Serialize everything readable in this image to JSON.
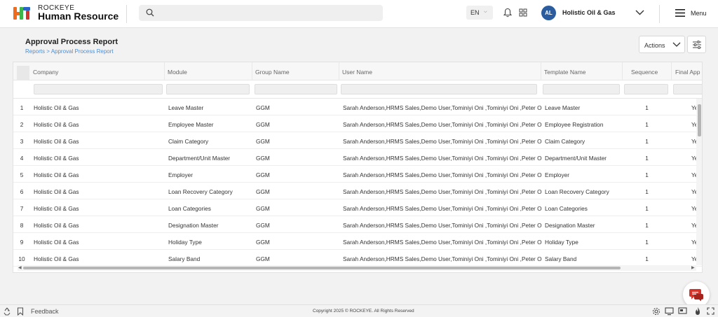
{
  "app": {
    "brand_top": "ROCKEYE",
    "brand_main": "Human Resource",
    "language": "EN",
    "avatar_initials": "AL",
    "organization": "Holistic Oil & Gas",
    "menu_label": "Menu"
  },
  "page": {
    "title": "Approval Process Report",
    "breadcrumb": "Reports > Approval Process Report",
    "actions_label": "Actions"
  },
  "table": {
    "columns": [
      "Company",
      "Module",
      "Group Name",
      "User Name",
      "Template Name",
      "Sequence",
      "Final App"
    ],
    "rows": [
      {
        "num": "1",
        "company": "Holistic Oil & Gas",
        "module": "Leave Master",
        "group": "GGM",
        "user": "Sarah Anderson,HRMS Sales,Demo User,Tominiyi Oni ,Tominiyi Oni ,Peter O",
        "template": "Leave Master",
        "sequence": "1",
        "final": "Ye"
      },
      {
        "num": "2",
        "company": "Holistic Oil & Gas",
        "module": "Employee Master",
        "group": "GGM",
        "user": "Sarah Anderson,HRMS Sales,Demo User,Tominiyi Oni ,Tominiyi Oni ,Peter O",
        "template": "Employee Registration",
        "sequence": "1",
        "final": "Ye"
      },
      {
        "num": "3",
        "company": "Holistic Oil & Gas",
        "module": "Claim Category",
        "group": "GGM",
        "user": "Sarah Anderson,HRMS Sales,Demo User,Tominiyi Oni ,Tominiyi Oni ,Peter O",
        "template": "Claim Category",
        "sequence": "1",
        "final": "Ye"
      },
      {
        "num": "4",
        "company": "Holistic Oil & Gas",
        "module": "Department/Unit Master",
        "group": "GGM",
        "user": "Sarah Anderson,HRMS Sales,Demo User,Tominiyi Oni ,Tominiyi Oni ,Peter O",
        "template": "Department/Unit Master",
        "sequence": "1",
        "final": "Ye"
      },
      {
        "num": "5",
        "company": "Holistic Oil & Gas",
        "module": "Employer",
        "group": "GGM",
        "user": "Sarah Anderson,HRMS Sales,Demo User,Tominiyi Oni ,Tominiyi Oni ,Peter O",
        "template": "Employer",
        "sequence": "1",
        "final": "Ye"
      },
      {
        "num": "6",
        "company": "Holistic Oil & Gas",
        "module": "Loan Recovery Category",
        "group": "GGM",
        "user": "Sarah Anderson,HRMS Sales,Demo User,Tominiyi Oni ,Tominiyi Oni ,Peter O",
        "template": "Loan Recovery Category",
        "sequence": "1",
        "final": "Ye"
      },
      {
        "num": "7",
        "company": "Holistic Oil & Gas",
        "module": "Loan Categories",
        "group": "GGM",
        "user": "Sarah Anderson,HRMS Sales,Demo User,Tominiyi Oni ,Tominiyi Oni ,Peter O",
        "template": "Loan Categories",
        "sequence": "1",
        "final": "Ye"
      },
      {
        "num": "8",
        "company": "Holistic Oil & Gas",
        "module": "Designation Master",
        "group": "GGM",
        "user": "Sarah Anderson,HRMS Sales,Demo User,Tominiyi Oni ,Tominiyi Oni ,Peter O",
        "template": "Designation Master",
        "sequence": "1",
        "final": "Ye"
      },
      {
        "num": "9",
        "company": "Holistic Oil & Gas",
        "module": "Holiday Type",
        "group": "GGM",
        "user": "Sarah Anderson,HRMS Sales,Demo User,Tominiyi Oni ,Tominiyi Oni ,Peter O",
        "template": "Holiday Type",
        "sequence": "1",
        "final": "Ye"
      },
      {
        "num": "10",
        "company": "Holistic Oil & Gas",
        "module": "Salary Band",
        "group": "GGM",
        "user": "Sarah Anderson,HRMS Sales,Demo User,Tominiyi Oni ,Tominiyi Oni ,Peter O",
        "template": "Salary Band",
        "sequence": "1",
        "final": "Ye"
      }
    ]
  },
  "footer": {
    "feedback_label": "Feedback",
    "copyright": "Copyright 2025 © ROCKEYE. All Rights Reserved"
  },
  "colors": {
    "accent": "#2a5c9e",
    "link": "#4a8fd6",
    "logo_orange": "#f26b1d",
    "logo_green": "#3cb54a",
    "logo_blue": "#2b63c9",
    "chat_red": "#d6332a"
  },
  "icons": [
    "logo",
    "search-icon",
    "chevron-down-icon",
    "bell-icon",
    "apps-grid-icon",
    "menu-icon",
    "filter-sliders-icon",
    "recycle-icon",
    "bookmark-icon",
    "chat-icon",
    "settings-icon",
    "monitor-icon",
    "flame-icon",
    "expand-icon"
  ]
}
